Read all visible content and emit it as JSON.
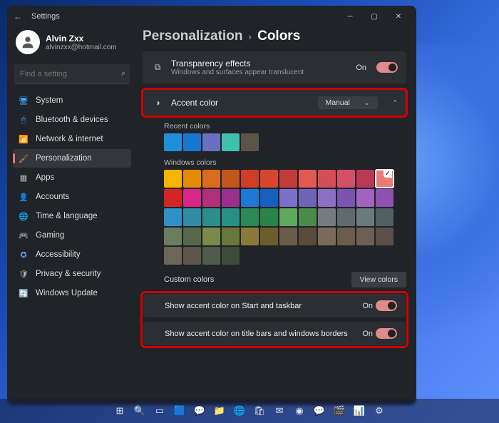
{
  "window": {
    "title": "Settings",
    "user": {
      "name": "Alvin Zxx",
      "email": "alvinzxx@hotmail.com"
    },
    "search_placeholder": "Find a setting"
  },
  "sidebar": {
    "items": [
      {
        "label": "System",
        "icon": "🖥",
        "color": "#3aa0ff"
      },
      {
        "label": "Bluetooth & devices",
        "icon": "🖱",
        "color": "#3aa0ff"
      },
      {
        "label": "Network & internet",
        "icon": "📶",
        "color": "#5cc3ff"
      },
      {
        "label": "Personalization",
        "icon": "🖌",
        "color": "#ff8a3d",
        "active": true
      },
      {
        "label": "Apps",
        "icon": "▦",
        "color": "#bbb"
      },
      {
        "label": "Accounts",
        "icon": "👤",
        "color": "#bbb"
      },
      {
        "label": "Time & language",
        "icon": "🌐",
        "color": "#ffd24a"
      },
      {
        "label": "Gaming",
        "icon": "🎮",
        "color": "#7ad17a"
      },
      {
        "label": "Accessibility",
        "icon": "✪",
        "color": "#6aa8ff"
      },
      {
        "label": "Privacy & security",
        "icon": "🛡",
        "color": "#bbb"
      },
      {
        "label": "Windows Update",
        "icon": "🔄",
        "color": "#6ad1ff"
      }
    ]
  },
  "breadcrumb": {
    "parent": "Personalization",
    "current": "Colors"
  },
  "cards": {
    "transparency": {
      "title": "Transparency effects",
      "sub": "Windows and surfaces appear translucent",
      "state": "On"
    },
    "accent": {
      "title": "Accent color",
      "dropdown": "Manual"
    },
    "custom": {
      "label": "Custom colors",
      "button": "View colors"
    },
    "startTaskbar": {
      "label": "Show accent color on Start and taskbar",
      "state": "On"
    },
    "titleBars": {
      "label": "Show accent color on title bars and windows borders",
      "state": "On"
    }
  },
  "recent": {
    "label": "Recent colors",
    "colors": [
      "#1e90d8",
      "#1976d2",
      "#6a6fbf",
      "#3fc1b0",
      "#5c5346"
    ]
  },
  "palette": {
    "label": "Windows colors",
    "colors": [
      "#f7b500",
      "#e68a00",
      "#d96c1e",
      "#c2571d",
      "#cf3e24",
      "#d8452a",
      "#c23b3a",
      "#e05a4f",
      "#d64d57",
      "#d55066",
      "#ba3a55",
      "#e97c74",
      "#d42525",
      "#d7258a",
      "#b03079",
      "#9a2f8e",
      "#1e78d8",
      "#1560bd",
      "#7b6fc9",
      "#6f63b8",
      "#8a6fc2",
      "#7a54af",
      "#a262c2",
      "#9050b0",
      "#2e91c7",
      "#2f8aa3",
      "#2a8f8a",
      "#279086",
      "#2a8a57",
      "#27834a",
      "#5ea85e",
      "#4a8a4a",
      "#747c80",
      "#5f6a6c",
      "#6a7a7c",
      "#536063",
      "#6a7d60",
      "#55684b",
      "#7a8a4a",
      "#66783a",
      "#8a7a3a",
      "#6e5d2c",
      "#6a5a4a",
      "#5a4a3a",
      "#796a5a",
      "#6b5c4d",
      "#6e5f55",
      "#5c4f47",
      "#6e6558",
      "#5c574a",
      "#4e5a4a",
      "#3e4a3a"
    ],
    "selected_index": 11
  },
  "taskbar_icons": [
    "start",
    "search",
    "taskview",
    "widgets",
    "chat",
    "explorer",
    "edge",
    "store",
    "mail",
    "chrome",
    "messenger",
    "video",
    "chart",
    "settings"
  ]
}
